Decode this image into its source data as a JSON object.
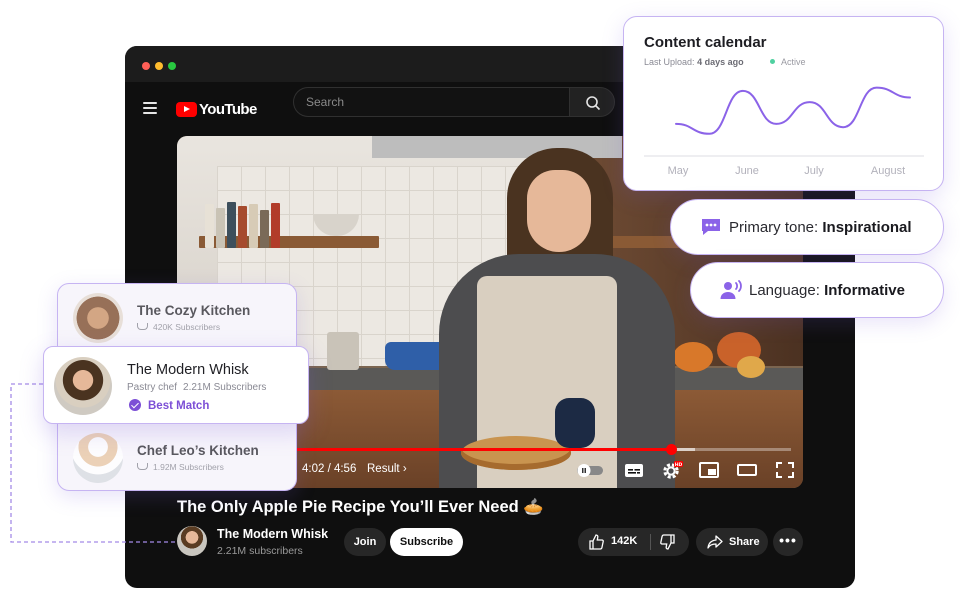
{
  "youtube": {
    "logo_text": "YouTube",
    "search": {
      "placeholder": "Search"
    },
    "video": {
      "progress_fraction": 0.8,
      "buffered_fraction": 0.84,
      "time": "4:02 / 4:56",
      "chapter": "Result",
      "hd_badge": "HD"
    },
    "title": "The Only Apple Pie Recipe You’ll Ever Need 🥧",
    "channel": {
      "name": "The Modern Whisk",
      "subscribers": "2.21M subscribers"
    },
    "join_label": "Join",
    "subscribe_label": "Subscribe",
    "likes": "142K",
    "share_label": "Share"
  },
  "calendar": {
    "title": "Content calendar",
    "last_upload_label": "Last Upload:",
    "last_upload_value": "4 days ago",
    "status": "Active",
    "accent": "#8b63e8",
    "chart_data": {
      "type": "line",
      "x": [
        "May",
        "June",
        "July",
        "August"
      ],
      "series": [
        {
          "values": [
            0.35,
            0.2,
            0.85,
            0.35,
            0.68,
            0.3,
            0.9,
            0.75
          ]
        }
      ]
    }
  },
  "tone": {
    "label": "Primary tone:",
    "value": "Inspirational",
    "icon": "chat-bubble-icon"
  },
  "language": {
    "label": "Language:",
    "value": "Informative",
    "icon": "speaking-person-icon"
  },
  "matches": [
    {
      "name": "The Cozy Kitchen",
      "subscribers": "420K Subscribers"
    },
    {
      "name": "The Modern Whisk",
      "role": "Pastry chef",
      "subscribers": "2.21M Subscribers",
      "badge": "Best Match"
    },
    {
      "name": "Chef Leo’s Kitchen",
      "subscribers": "1.92M Subscribers"
    }
  ]
}
